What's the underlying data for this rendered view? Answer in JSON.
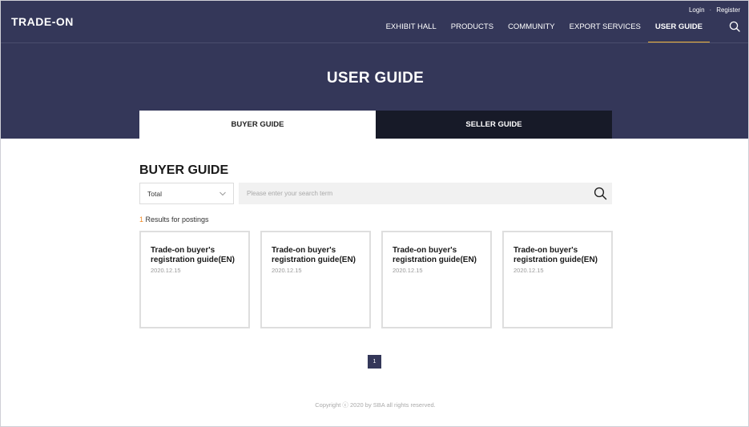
{
  "header": {
    "logo": "TRADE-ON",
    "util": {
      "login": "Login",
      "separator": "·",
      "register": "Register"
    },
    "nav": [
      {
        "label": "EXHIBIT HALL"
      },
      {
        "label": "PRODUCTS"
      },
      {
        "label": "COMMUNITY"
      },
      {
        "label": "EXPORT SERVICES"
      },
      {
        "label": "USER GUIDE",
        "active": true
      }
    ],
    "search_icon": "search-icon"
  },
  "hero": {
    "title": "USER GUIDE"
  },
  "tabs": [
    {
      "label": "BUYER GUIDE",
      "active": true
    },
    {
      "label": "SELLER GUIDE",
      "active": false
    }
  ],
  "main": {
    "section_title": "BUYER GUIDE",
    "filter": {
      "selected": "Total"
    },
    "search": {
      "placeholder": "Please enter your search term"
    },
    "results": {
      "count": "1",
      "label": " Results for postings"
    },
    "cards": [
      {
        "title": "Trade-on buyer's registration guide(EN)",
        "date": "2020.12.15"
      },
      {
        "title": "Trade-on buyer's registration guide(EN)",
        "date": "2020.12.15"
      },
      {
        "title": "Trade-on buyer's registration guide(EN)",
        "date": "2020.12.15"
      },
      {
        "title": "Trade-on buyer's registration guide(EN)",
        "date": "2020.12.15"
      }
    ],
    "pagination": {
      "current": "1"
    }
  },
  "footer": {
    "copyright": "Copyright ⓒ 2020 by SBA all rights reserved."
  },
  "colors": {
    "header_bg": "#343759",
    "active_underline": "#f0b43a",
    "tab_dark": "#171a28",
    "accent_orange": "#f08a24"
  }
}
